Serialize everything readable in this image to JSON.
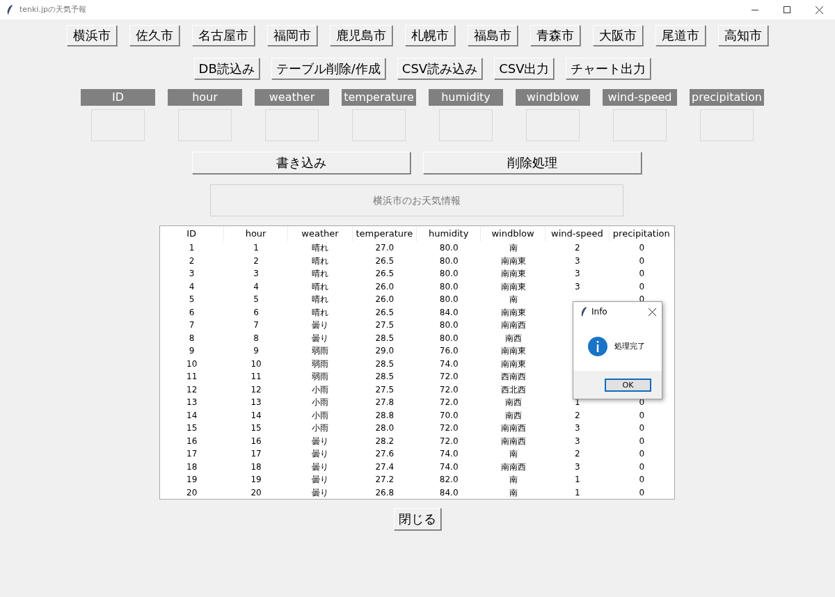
{
  "window": {
    "title": "tenki.jpの天気予報"
  },
  "cities": [
    "横浜市",
    "佐久市",
    "名古屋市",
    "福岡市",
    "鹿児島市",
    "札幌市",
    "福島市",
    "青森市",
    "大阪市",
    "尾道市",
    "高知市"
  ],
  "actions": [
    "DB読込み",
    "テーブル削除/作成",
    "CSV読み込み",
    "CSV出力",
    "チャート出力"
  ],
  "fields": [
    {
      "label": "ID"
    },
    {
      "label": "hour"
    },
    {
      "label": "weather"
    },
    {
      "label": "temperature"
    },
    {
      "label": "humidity"
    },
    {
      "label": "windblow"
    },
    {
      "label": "wind-speed"
    },
    {
      "label": "precipitation"
    }
  ],
  "edit_buttons": [
    "書き込み",
    "削除処理"
  ],
  "info_label": "横浜市のお天気情報",
  "table": {
    "columns": [
      "ID",
      "hour",
      "weather",
      "temperature",
      "humidity",
      "windblow",
      "wind-speed",
      "precipitation"
    ],
    "rows": [
      [
        "1",
        "1",
        "晴れ",
        "27.0",
        "80.0",
        "南",
        "2",
        "0"
      ],
      [
        "2",
        "2",
        "晴れ",
        "26.5",
        "80.0",
        "南南東",
        "3",
        "0"
      ],
      [
        "3",
        "3",
        "晴れ",
        "26.5",
        "80.0",
        "南南東",
        "3",
        "0"
      ],
      [
        "4",
        "4",
        "晴れ",
        "26.0",
        "80.0",
        "南南東",
        "3",
        "0"
      ],
      [
        "5",
        "5",
        "晴れ",
        "26.0",
        "80.0",
        "南",
        null,
        "0"
      ],
      [
        "6",
        "6",
        "晴れ",
        "26.5",
        "84.0",
        "南南東"
      ],
      [
        "7",
        "7",
        "曇り",
        "27.5",
        "80.0",
        "南南西"
      ],
      [
        "8",
        "8",
        "曇り",
        "28.5",
        "80.0",
        "南西"
      ],
      [
        "9",
        "9",
        "弱雨",
        "29.0",
        "76.0",
        "南南東"
      ],
      [
        "10",
        "10",
        "弱雨",
        "28.5",
        "74.0",
        "南南東"
      ],
      [
        "11",
        "11",
        "弱雨",
        "28.5",
        "72.0",
        "西南西"
      ],
      [
        "12",
        "12",
        "小雨",
        "27.5",
        "72.0",
        "西北西"
      ],
      [
        "13",
        "13",
        "小雨",
        "27.8",
        "72.0",
        "南西",
        "1",
        "0"
      ],
      [
        "14",
        "14",
        "小雨",
        "28.8",
        "70.0",
        "南西",
        "2",
        "0"
      ],
      [
        "15",
        "15",
        "小雨",
        "28.0",
        "72.0",
        "南南西",
        "3",
        "0"
      ],
      [
        "16",
        "16",
        "曇り",
        "28.2",
        "72.0",
        "南南西",
        "3",
        "0"
      ],
      [
        "17",
        "17",
        "曇り",
        "27.6",
        "74.0",
        "南",
        "2",
        "0"
      ],
      [
        "18",
        "18",
        "曇り",
        "27.4",
        "74.0",
        "南南西",
        "3",
        "0"
      ],
      [
        "19",
        "19",
        "曇り",
        "27.2",
        "82.0",
        "南",
        "1",
        "0"
      ],
      [
        "20",
        "20",
        "曇り",
        "26.8",
        "84.0",
        "南",
        "1",
        "0"
      ]
    ]
  },
  "close_button": "閉じる",
  "dialog": {
    "title": "Info",
    "message": "処理完了",
    "ok": "OK"
  }
}
